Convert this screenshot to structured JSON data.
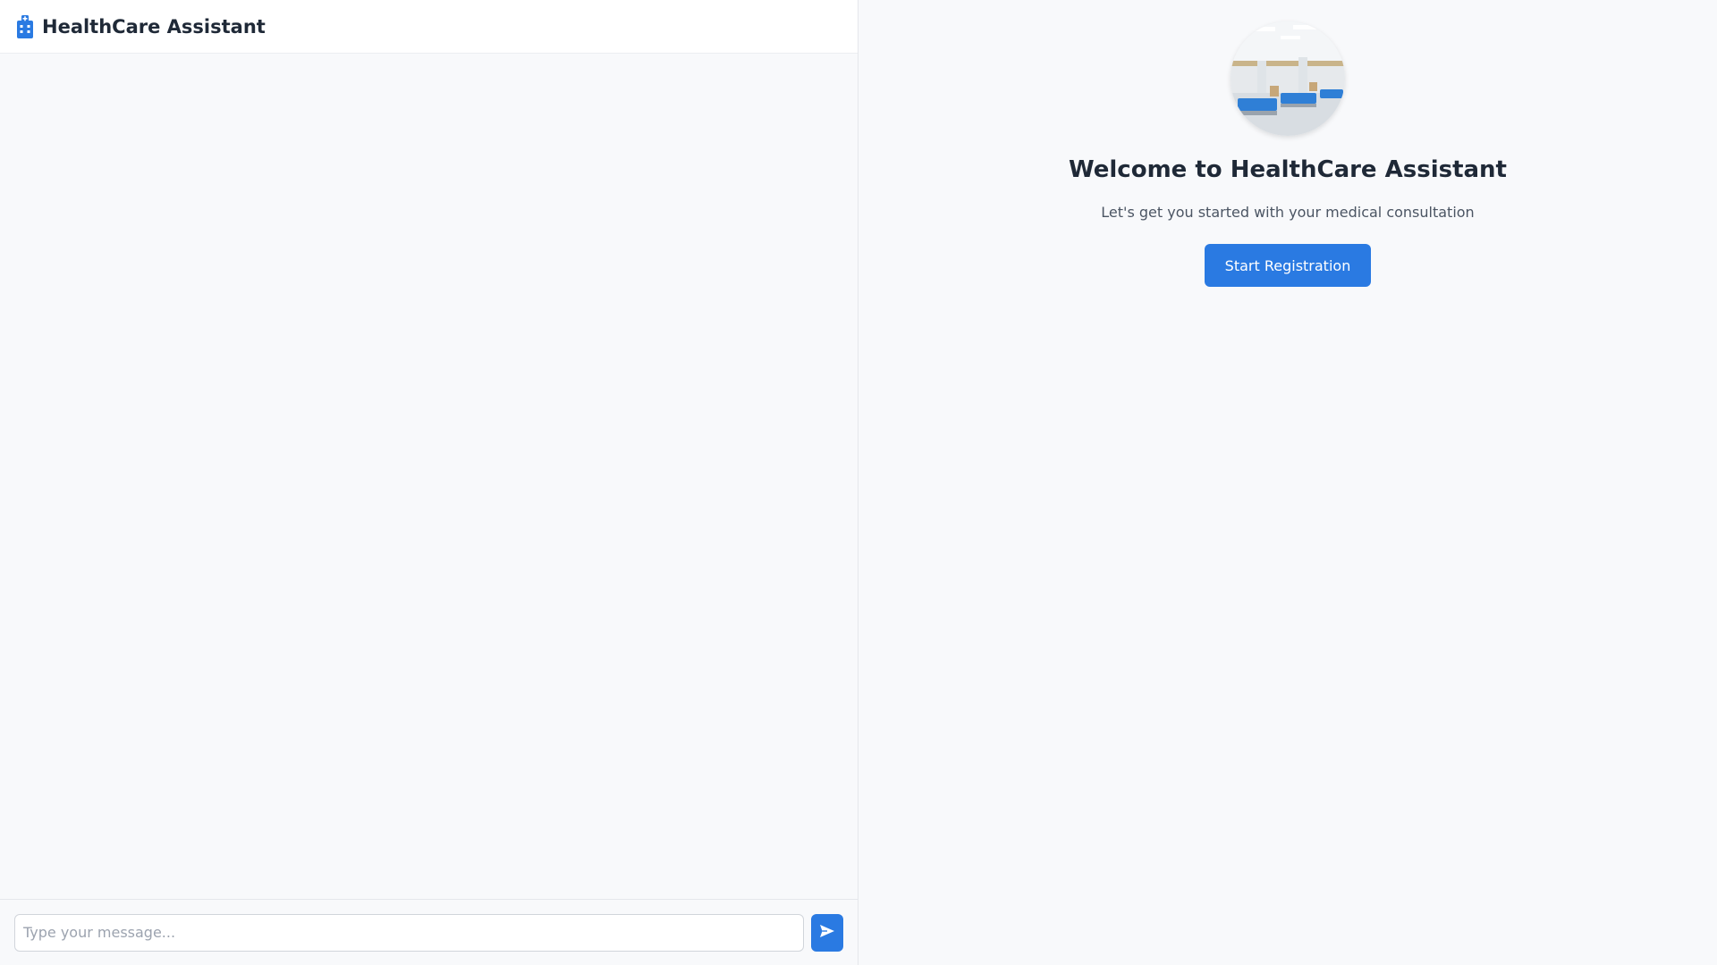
{
  "header": {
    "title": "HealthCare Assistant",
    "icon": "hospital-icon"
  },
  "composer": {
    "placeholder": "Type your message...",
    "value": "",
    "send_icon": "send-icon"
  },
  "welcome": {
    "image": "hospital-ward-photo",
    "title": "Welcome to HealthCare Assistant",
    "subtitle": "Let's get you started with your medical consultation",
    "button_label": "Start Registration"
  },
  "colors": {
    "accent": "#2a7ae2",
    "background": "#f8f9fb",
    "header_bg": "#ffffff",
    "title_text": "#1f2937"
  }
}
